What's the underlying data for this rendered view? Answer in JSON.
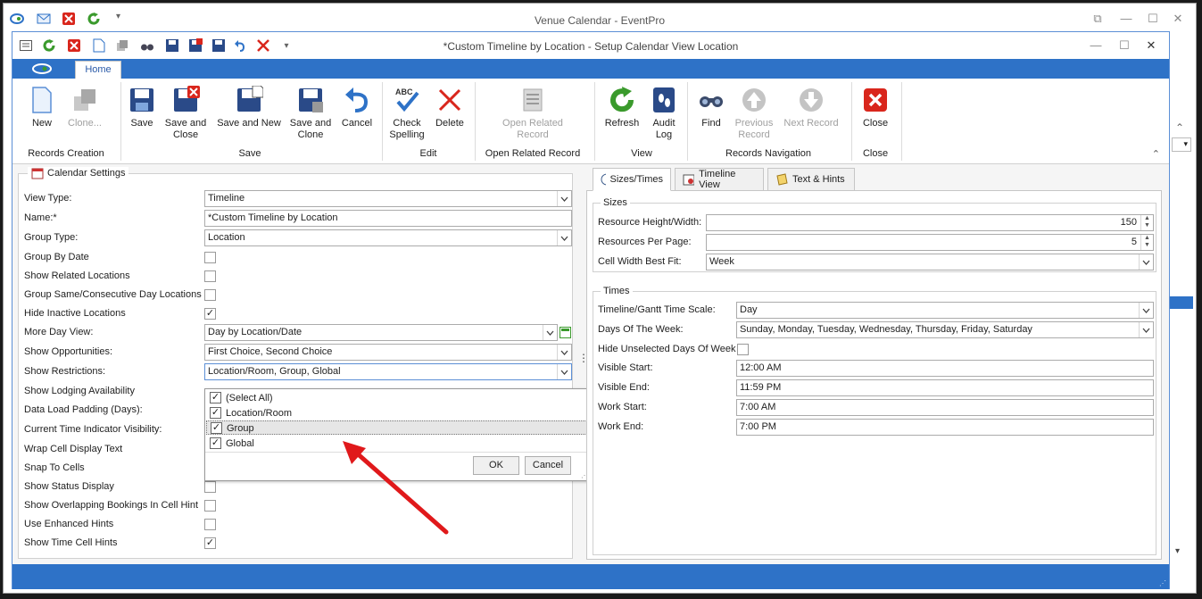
{
  "outer_window": {
    "title": "Venue Calendar - EventPro"
  },
  "window": {
    "title": "*Custom Timeline by Location - Setup Calendar View Location"
  },
  "ribbon": {
    "tab_home": "Home",
    "buttons": {
      "new": "New",
      "clone": "Clone...",
      "save": "Save",
      "save_close_1": "Save and",
      "save_close_2": "Close",
      "save_new": "Save and New",
      "save_clone_1": "Save and",
      "save_clone_2": "Clone",
      "cancel": "Cancel",
      "check_1": "Check",
      "check_2": "Spelling",
      "delete": "Delete",
      "open_related_1": "Open Related",
      "open_related_2": "Record",
      "refresh": "Refresh",
      "audit_1": "Audit",
      "audit_2": "Log",
      "find": "Find",
      "prev_1": "Previous",
      "prev_2": "Record",
      "next": "Next Record",
      "close": "Close",
      "abc": "ABC"
    },
    "groups": {
      "records_creation": "Records Creation",
      "save": "Save",
      "edit": "Edit",
      "open_related": "Open Related Record",
      "view": "View",
      "records_navigation": "Records Navigation",
      "close": "Close"
    }
  },
  "calendar_settings": {
    "legend": "Calendar Settings",
    "labels": {
      "view_type": "View Type:",
      "name": "Name:*",
      "group_type": "Group Type:",
      "group_by_date": "Group By Date",
      "show_related": "Show Related Locations",
      "group_same": "Group Same/Consecutive Day Locations",
      "hide_inactive": "Hide Inactive Locations",
      "more_day_view": "More Day View:",
      "show_opportunities": "Show Opportunities:",
      "show_restrictions": "Show Restrictions:",
      "show_lodging": "Show Lodging Availability",
      "data_load": "Data Load Padding (Days):",
      "current_time": "Current Time Indicator Visibility:",
      "wrap_cell": "Wrap Cell Display Text",
      "snap": "Snap To Cells",
      "show_status": "Show Status Display",
      "show_overlapping": "Show Overlapping Bookings In Cell Hint",
      "enhanced_hints": "Use Enhanced Hints",
      "time_cell_hints": "Show Time Cell Hints"
    },
    "values": {
      "view_type": "Timeline",
      "name": "*Custom Timeline by Location",
      "group_type": "Location",
      "more_day_view": "Day by Location/Date",
      "show_opportunities": "First Choice, Second Choice",
      "show_restrictions": "Location/Room, Group, Global"
    },
    "checks": {
      "group_by_date": "",
      "show_related": "",
      "group_same": "",
      "hide_inactive": "✓",
      "show_status": "",
      "show_overlapping": "",
      "enhanced_hints": "",
      "time_cell_hints": "✓"
    }
  },
  "dropdown": {
    "items": [
      "(Select All)",
      "Location/Room",
      "Group",
      "Global"
    ],
    "check_mark": "✓",
    "ok": "OK",
    "cancel": "Cancel"
  },
  "right_tabs": {
    "sizes_times": "Sizes/Times",
    "timeline_view": "Timeline View",
    "text_hints": "Text & Hints"
  },
  "sizes": {
    "legend": "Sizes",
    "resource_hw_label": "Resource Height/Width:",
    "resource_hw": "150",
    "resources_per_page_label": "Resources Per Page:",
    "resources_per_page": "5",
    "cell_width_label": "Cell Width Best Fit:",
    "cell_width": "Week"
  },
  "times": {
    "legend": "Times",
    "scale_label": "Timeline/Gantt Time Scale:",
    "scale": "Day",
    "days_label": "Days Of The Week:",
    "days": "Sunday, Monday, Tuesday, Wednesday, Thursday, Friday, Saturday",
    "hide_unselected_label": "Hide Unselected Days Of Week",
    "visible_start_label": "Visible Start:",
    "visible_start": "12:00 AM",
    "visible_end_label": "Visible End:",
    "visible_end": "11:59 PM",
    "work_start_label": "Work Start:",
    "work_start": "7:00 AM",
    "work_end_label": "Work End:",
    "work_end": "7:00 PM"
  },
  "colors": {
    "accent": "#2e72c7",
    "arrow": "#e0191b",
    "close_red": "#d9261c",
    "refresh_green": "#3a9a2c"
  }
}
